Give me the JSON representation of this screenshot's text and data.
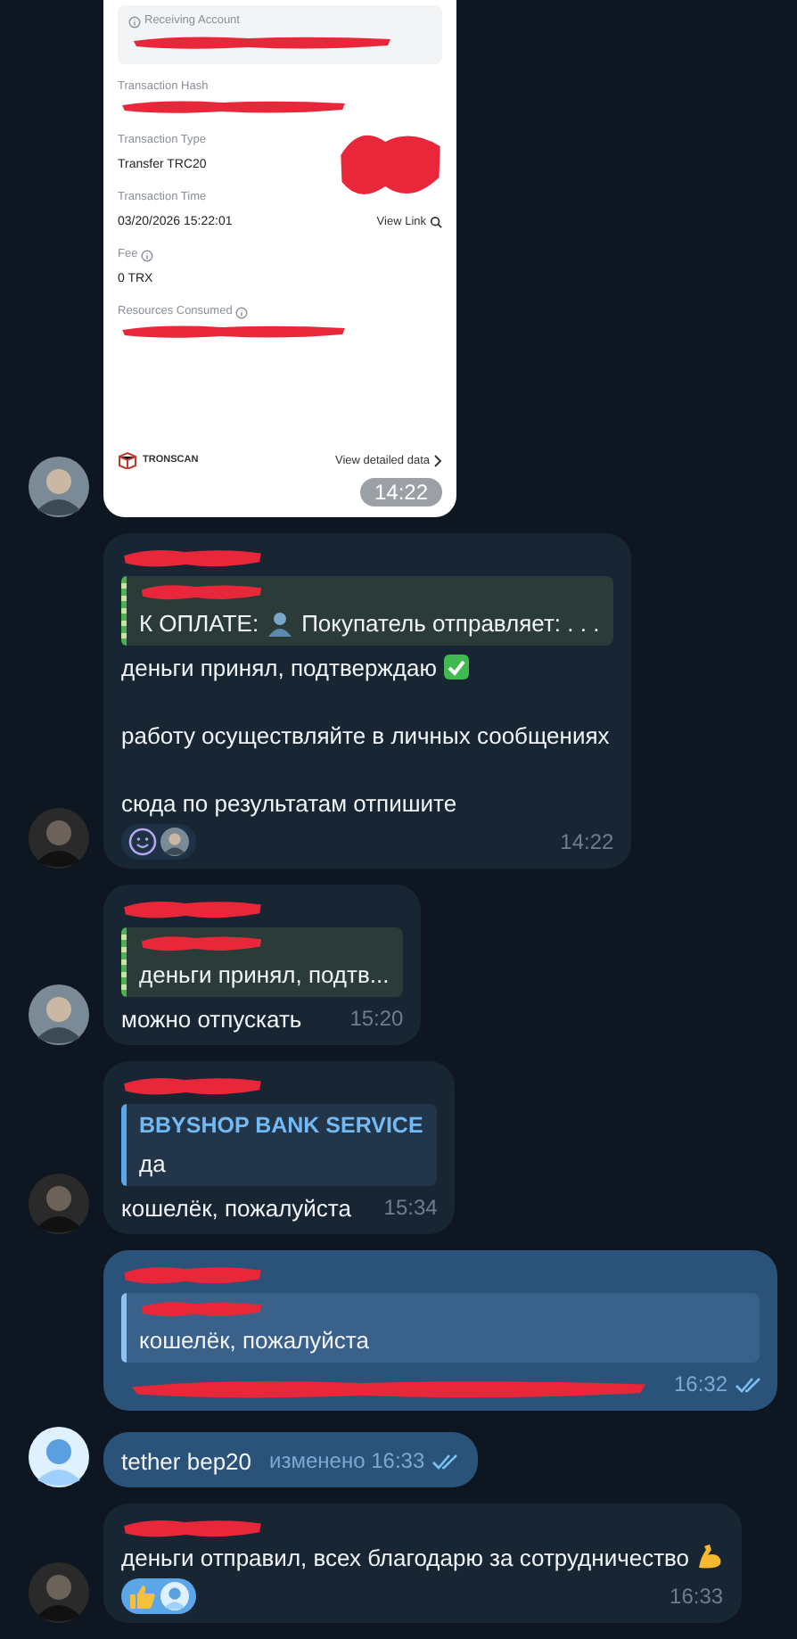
{
  "messages": [
    {
      "kind": "incoming",
      "avatar": {
        "kind": "photo"
      },
      "time": "14:22",
      "receipt": {
        "account": {
          "label": "Receiving Account",
          "redacted": true
        },
        "fields": [
          {
            "label": "Transaction Hash",
            "info": false,
            "redacted": true
          },
          {
            "label": "Transaction Type",
            "info": false,
            "redacted": false,
            "value": "Transfer TRC20"
          },
          {
            "label": "Transaction Time",
            "info": false,
            "redacted": false,
            "value": "03/20/2026 15:22:01"
          },
          {
            "label": "Fee",
            "info": true,
            "redacted": false,
            "value": "0 TRX"
          },
          {
            "label": "Resources Consumed",
            "info": true,
            "redacted": true
          }
        ],
        "qr_redacted": true,
        "view_link": "View Link",
        "brand": "TRONSCAN",
        "details_link": "View detailed data"
      }
    },
    {
      "kind": "incoming",
      "avatar": {
        "kind": "dark"
      },
      "sender_redacted": true,
      "quote": {
        "name_redacted": true,
        "color": "#4caf50",
        "striped": true,
        "before": "К ОПЛАТЕ:",
        "icon": {
          "kind": "person"
        },
        "after": "Покупатель отправляет: . . ."
      },
      "paragraphs": [
        {
          "text": "деньги принял, подтверждаю",
          "emoji": {
            "kind": "check"
          }
        },
        {
          "text": "работу осуществляйте в личных сообщениях"
        },
        {
          "text": "сюда по результатам отпишите"
        }
      ],
      "reactions": [
        {
          "kind": "smiley",
          "selected": false,
          "avatar": {
            "kind": "photo"
          }
        }
      ],
      "time": "14:22"
    },
    {
      "kind": "incoming",
      "avatar": {
        "kind": "photo"
      },
      "sender_redacted": true,
      "quote": {
        "name_redacted": true,
        "color": "#4caf50",
        "striped": true,
        "before": "деньги принял, подтв..."
      },
      "paragraphs": [
        {
          "text": "можно отпускать"
        }
      ],
      "time": "15:20"
    },
    {
      "kind": "incoming",
      "avatar": {
        "kind": "dark"
      },
      "sender_redacted": true,
      "quote": {
        "name_redacted": false,
        "name": "BBYSHOP BANK SERVICE",
        "color": "#5aa6e8",
        "striped": false,
        "before": "да"
      },
      "paragraphs": [
        {
          "text": "кошелёк, пожалуйста"
        }
      ],
      "time": "15:34"
    },
    {
      "kind": "outgoing",
      "sender_redacted": true,
      "quote": {
        "name_redacted": true,
        "color": "#8fc2ef",
        "striped": false,
        "before": "кошелёк, пожалуйста"
      },
      "body_redacted": true,
      "time": "16:32",
      "read": true
    },
    {
      "kind": "outgoing",
      "avatar": {
        "kind": "logo"
      },
      "paragraphs": [
        {
          "text": "tether bep20"
        }
      ],
      "edited": "изменено",
      "time": "16:33",
      "read": true
    },
    {
      "kind": "incoming",
      "avatar": {
        "kind": "dark"
      },
      "sender_redacted": true,
      "paragraphs": [
        {
          "text": "деньги отправил, всех благодарю за сотрудничество",
          "emoji": {
            "kind": "arm"
          }
        }
      ],
      "reactions": [
        {
          "kind": "thumbs-up",
          "selected": true,
          "avatar": {
            "kind": "logo"
          }
        }
      ],
      "time": "16:33"
    }
  ]
}
